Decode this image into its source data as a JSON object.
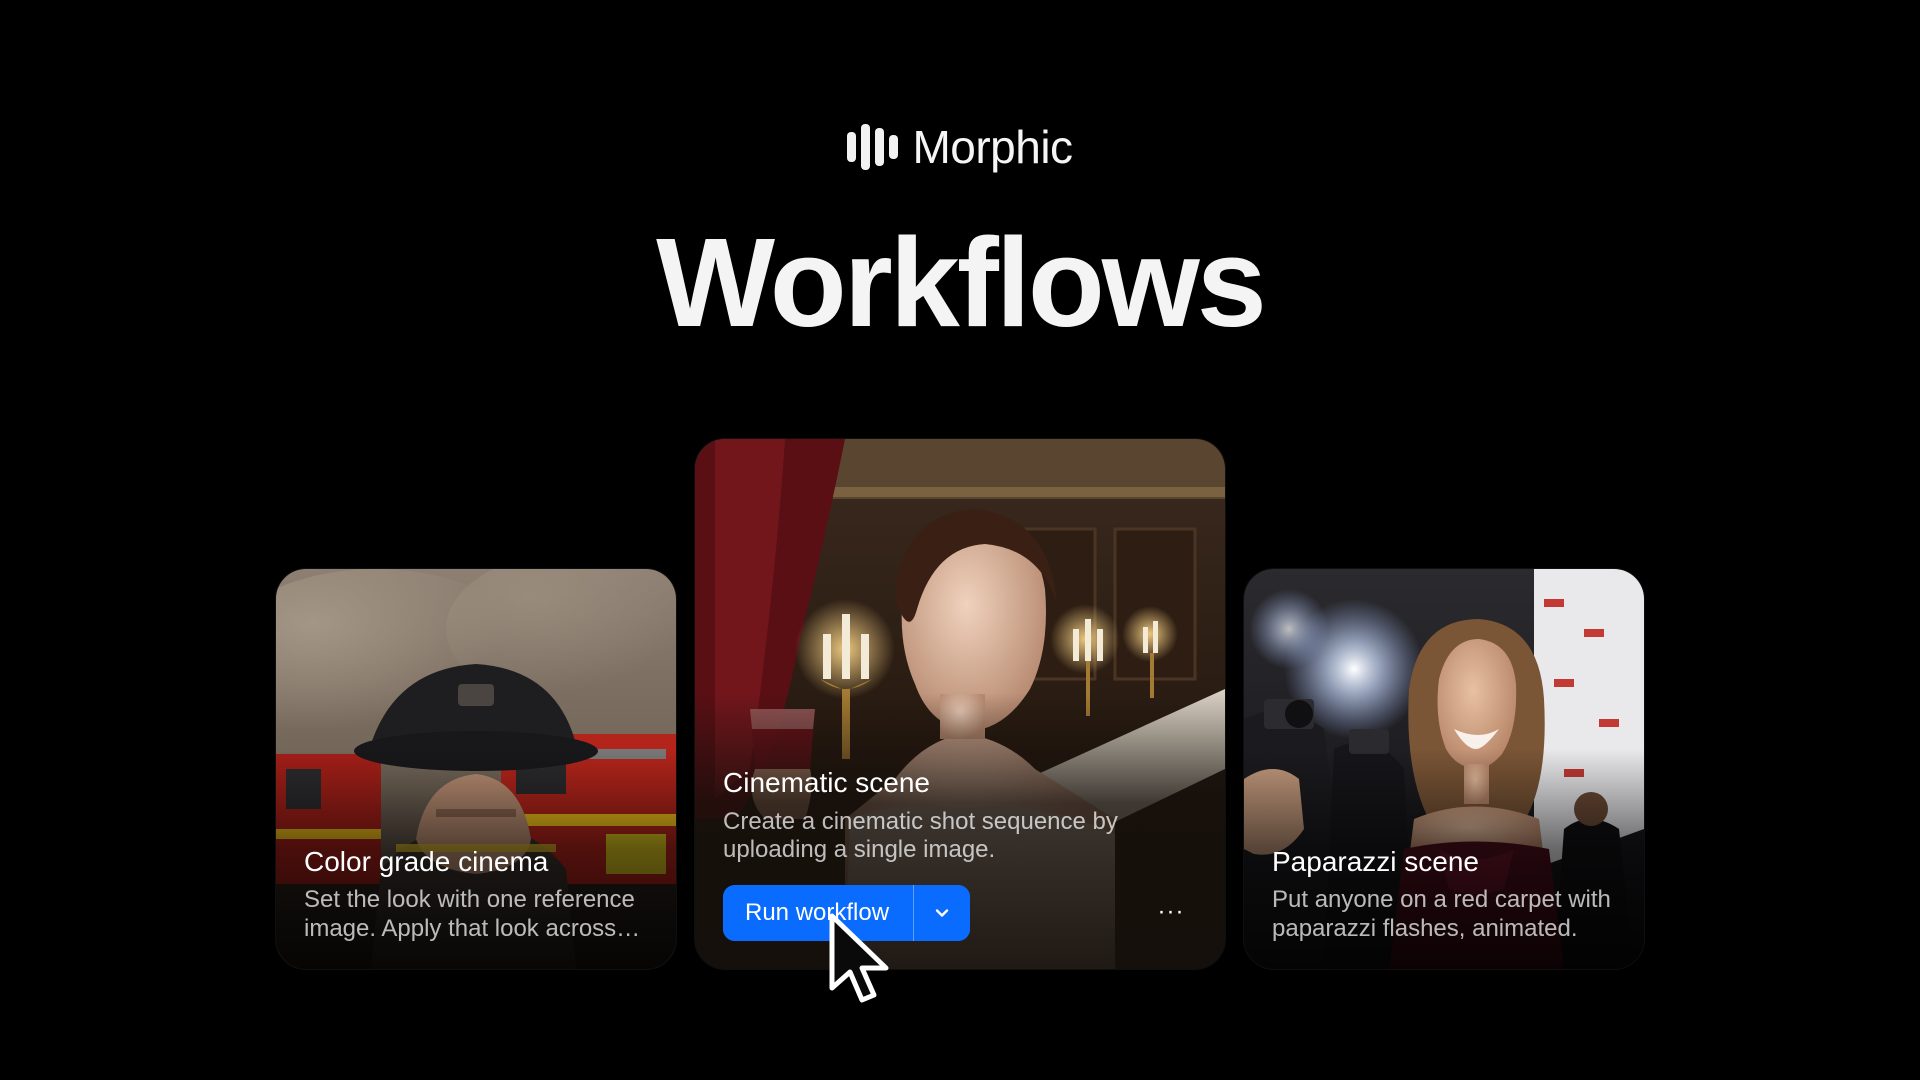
{
  "brand": {
    "name": "Morphic",
    "icon": "morphic-bars-logo-icon"
  },
  "page": {
    "title": "Workflows"
  },
  "cards": {
    "left": {
      "title": "Color grade cinema",
      "description": "Set the look with one reference image. Apply that look across multiple clips.",
      "image": "firefighter-fire-truck-smoke-photo"
    },
    "center": {
      "title": "Cinematic scene",
      "description": "Create a cinematic shot sequence by uploading a single image.",
      "image": "woman-candlelit-dining-room-wine-photo",
      "run_label": "Run workflow",
      "dropdown_icon": "chevron-down-icon",
      "more_icon": "more-horizontal-icon",
      "more_label": "···"
    },
    "right": {
      "title": "Paparazzi scene",
      "description": "Put anyone on a red carpet with paparazzi flashes, animated.",
      "image": "red-carpet-paparazzi-photo"
    }
  },
  "colors": {
    "background": "#000000",
    "accent": "#0A6CFF",
    "text": "#FFFFFF"
  },
  "pointer": {
    "icon": "mouse-pointer-icon"
  }
}
